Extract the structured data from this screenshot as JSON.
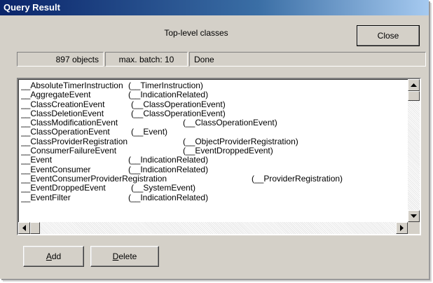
{
  "window": {
    "title": "Query Result"
  },
  "header": {
    "label": "Top-level classes",
    "close_label": "Close"
  },
  "status": {
    "count": "897 objects",
    "batch": "max. batch: 10",
    "state": "Done"
  },
  "list": {
    "rows": [
      {
        "name": "__AbsoluteTimerInstruction",
        "parent": "(__TimerInstruction)"
      },
      {
        "name": "__AggregateEvent",
        "parent": "(__IndicationRelated)"
      },
      {
        "name": "__ClassCreationEvent",
        "parent": "(__ClassOperationEvent)"
      },
      {
        "name": "__ClassDeletionEvent",
        "parent": "(__ClassOperationEvent)"
      },
      {
        "name": "__ClassModificationEvent",
        "parent": "(__ClassOperationEvent)"
      },
      {
        "name": "__ClassOperationEvent",
        "parent": "(__Event)"
      },
      {
        "name": "__ClassProviderRegistration",
        "parent": "(__ObjectProviderRegistration)"
      },
      {
        "name": "__ConsumerFailureEvent",
        "parent": "(__EventDroppedEvent)"
      },
      {
        "name": "__Event",
        "parent": "(__IndicationRelated)"
      },
      {
        "name": "__EventConsumer",
        "parent": "(__IndicationRelated)"
      },
      {
        "name": "__EventConsumerProviderRegistration",
        "parent": "(__ProviderRegistration)"
      },
      {
        "name": "__EventDroppedEvent",
        "parent": "(__SystemEvent)"
      },
      {
        "name": "__EventFilter",
        "parent": "(__IndicationRelated)"
      }
    ]
  },
  "footer": {
    "add_label": "Add",
    "add_mnemonic": "A",
    "add_rest": "dd",
    "delete_mnemonic": "D",
    "delete_rest": "elete"
  }
}
